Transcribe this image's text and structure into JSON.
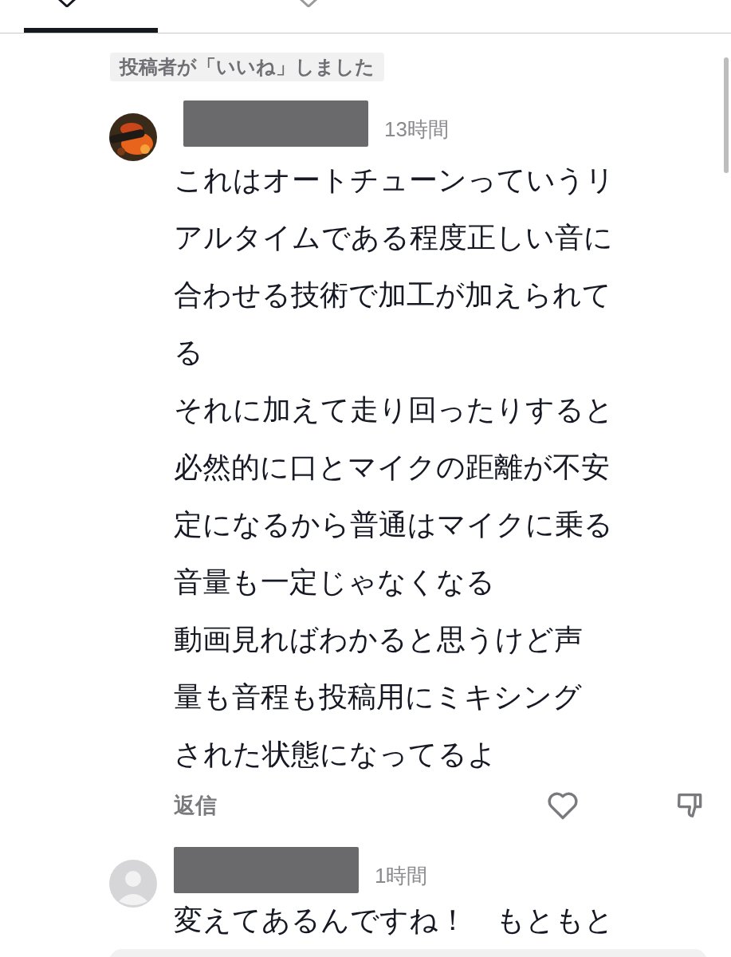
{
  "tabs": [
    {
      "selected": true
    },
    {
      "selected": false
    }
  ],
  "creator_badge": "投稿者が「いいね」しました",
  "comments": [
    {
      "time": "13時間",
      "lines": [
        "これはオートチューンっていうリ",
        "アルタイムである程度正しい音に",
        "合わせる技術で加工が加えられて",
        "る",
        "それに加えて走り回ったりすると",
        "必然的に口とマイクの距離が不安",
        "定になるから普通はマイクに乗る",
        "音量も一定じゃなくなる",
        "動画見ればわかると思うけど声",
        "量も音程も投稿用にミキシング",
        "された状態になってるよ"
      ],
      "reply": "返信",
      "liked": false
    },
    {
      "avatar": {
        "kind": "default"
      },
      "time": "1時間",
      "lines": [
        "変えてあるんですね！　もともと"
      ]
    }
  ]
}
